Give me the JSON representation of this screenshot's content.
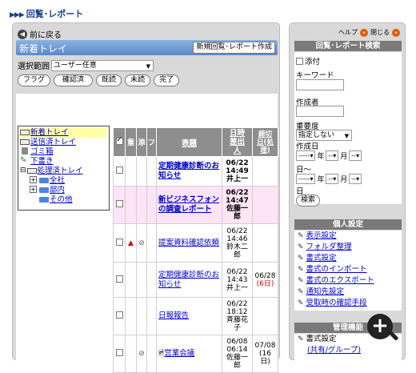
{
  "page": {
    "title": "回覧･レポート"
  },
  "nav": {
    "back_label": "前に戻る"
  },
  "header": {
    "tray_title": "新着トレイ",
    "new_button": "新規回覧･レポート作成"
  },
  "filter": {
    "label": "選択範囲",
    "value": "ユーザー任意"
  },
  "actions": [
    "フラグ",
    "確認済",
    "既読",
    "未読",
    "完了"
  ],
  "tree": [
    {
      "label": "新着トレイ",
      "icon": "tray-icon",
      "selected": true
    },
    {
      "label": "送信済トレイ",
      "icon": "tray-icon"
    },
    {
      "label": "ゴミ箱",
      "icon": "trash-icon"
    },
    {
      "label": "下書き",
      "icon": "draft-icon"
    },
    {
      "label": "処理済トレイ",
      "icon": "processed-tray-icon"
    },
    {
      "label": "全社",
      "icon": "folder-icon"
    },
    {
      "label": "部内",
      "icon": "folder-icon"
    },
    {
      "label": "その他",
      "icon": "folder-icon"
    }
  ],
  "table": {
    "headers": {
      "priority": "重",
      "attach": "添",
      "flag": "フ",
      "subject": "表題",
      "sent": "日時差出人",
      "deadline": "締切日(処理)"
    },
    "rows": [
      {
        "subject": "定期健康診断のお知らせ",
        "date": "06/22",
        "time": "14:49",
        "from": "井上一",
        "deadline": "",
        "due": "",
        "unread": true,
        "highlight": false,
        "priority": false,
        "attach": false
      },
      {
        "subject": "新ビジネスフォンの調査レポート",
        "date": "06/22",
        "time": "14:47",
        "from": "佐藤一郎",
        "deadline": "",
        "due": "",
        "unread": true,
        "highlight": true,
        "priority": false,
        "attach": false
      },
      {
        "subject": "提案資料確認依頼",
        "date": "06/22",
        "time": "14:46",
        "from": "鈴木二郎",
        "deadline": "",
        "due": "",
        "unread": false,
        "highlight": false,
        "priority": true,
        "attach": true
      },
      {
        "subject": "定期健康診断のお知らせ",
        "date": "06/22",
        "time": "14:43",
        "from": "井上一",
        "deadline": "06/28",
        "due": "(6日)",
        "unread": false,
        "highlight": false,
        "priority": false,
        "attach": false
      },
      {
        "subject": "日報報告",
        "date": "06/22",
        "time": "18:12",
        "from": "斉藤花子",
        "deadline": "",
        "due": "",
        "unread": false,
        "highlight": false,
        "priority": false,
        "attach": false
      },
      {
        "subject": "営業会議",
        "date": "06/08",
        "time": "06:14",
        "from": "佐藤一郎",
        "deadline": "07/08",
        "due": "(16日)",
        "unread": false,
        "highlight": false,
        "priority": false,
        "attach": true
      }
    ]
  },
  "side": {
    "help": "ヘルプ",
    "close": "閉じる",
    "search_title": "回覧･レポート検索",
    "attach_label": "添付",
    "keyword_label": "キーワード",
    "author_label": "作成者",
    "importance_label": "重要度",
    "importance_value": "指定しない",
    "created_label": "作成日",
    "date_placeholder": "-----",
    "year": "年",
    "month": "月",
    "day": "日",
    "tilde": "日～",
    "mmdd_placeholder": "--",
    "search_button": "検索",
    "personal_title": "個人設定",
    "personal_links": [
      "表示設定",
      "フォルダ整理",
      "書式設定",
      "書式のインポート",
      "書式のエクスポート",
      "通知先設定",
      "受取時の確認手段"
    ],
    "admin_title": "管理機能",
    "admin_links": [
      "書式設定",
      "(共有/グループ)"
    ]
  }
}
